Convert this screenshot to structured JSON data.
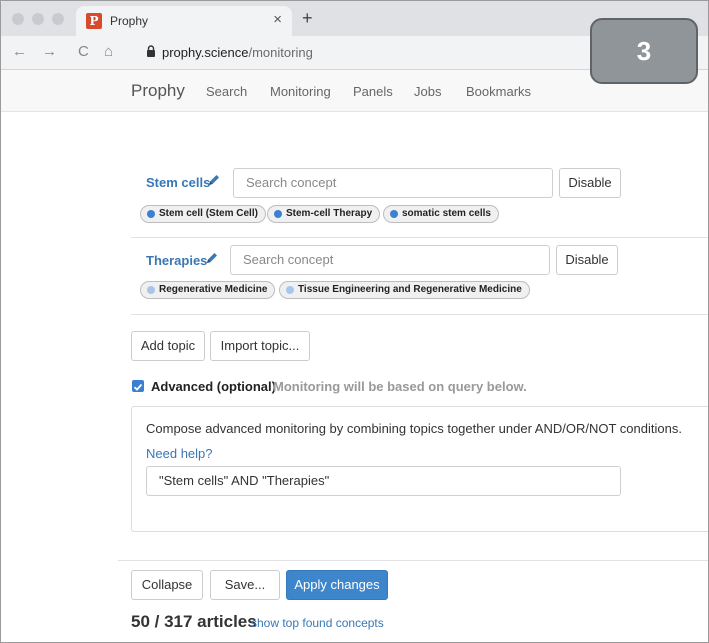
{
  "browser": {
    "tab_favicon": "P",
    "tab_title": "Prophy",
    "tab_close": "×",
    "new_tab": "+",
    "url_host": "prophy.science",
    "url_path": "/monitoring",
    "back_icon": "←",
    "forward_icon": "→",
    "reload_icon": "C",
    "home_icon": "⌂"
  },
  "overlay_badge": "3",
  "nav": {
    "brand": "Prophy",
    "links": [
      "Search",
      "Monitoring",
      "Panels",
      "Jobs",
      "Bookmarks"
    ]
  },
  "topics": [
    {
      "name": "Stem cells",
      "search_placeholder": "Search concept",
      "disable_label": "Disable",
      "concepts": [
        {
          "label": "Stem cell (Stem Cell)",
          "dot_color": "#3d7fd0"
        },
        {
          "label": "Stem-cell Therapy",
          "dot_color": "#3d7fd0"
        },
        {
          "label": "somatic stem cells",
          "dot_color": "#3d7fd0"
        }
      ]
    },
    {
      "name": "Therapies",
      "search_placeholder": "Search concept",
      "disable_label": "Disable",
      "concepts": [
        {
          "label": "Regenerative Medicine",
          "dot_color": "#a9c6ea"
        },
        {
          "label": "Tissue Engineering and Regenerative Medicine",
          "dot_color": "#a9c6ea"
        }
      ]
    }
  ],
  "actions": {
    "add_topic": "Add topic",
    "import_topic": "Import topic..."
  },
  "advanced": {
    "checked": true,
    "label": "Advanced (optional)",
    "note": "Monitoring will be based on query below.",
    "description": "Compose advanced monitoring by combining topics together under AND/OR/NOT conditions.",
    "help_link": "Need help?",
    "query": "\"Stem cells\" AND \"Therapies\""
  },
  "footer": {
    "collapse": "Collapse",
    "save": "Save...",
    "apply": "Apply changes",
    "articles": "50 / 317 articles",
    "show_concepts": "show top found concepts"
  },
  "colors": {
    "accent": "#3d86cc",
    "link": "#3a77b5"
  }
}
